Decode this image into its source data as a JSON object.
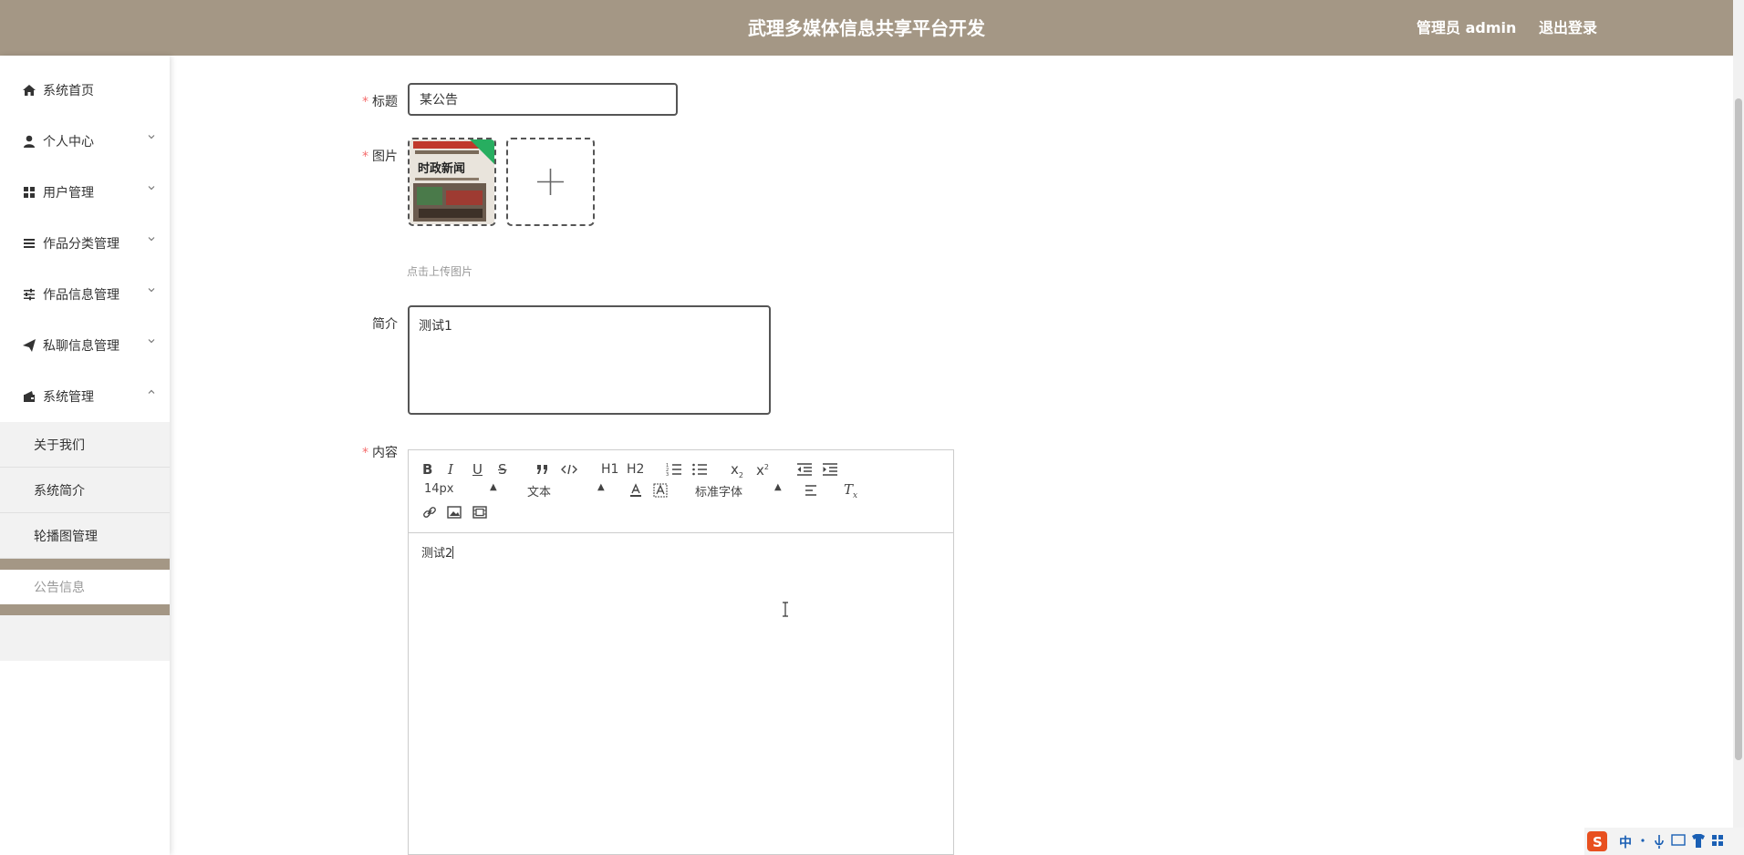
{
  "header": {
    "title": "武理多媒体信息共享平台开发",
    "admin_label": "管理员 admin",
    "logout_label": "退出登录"
  },
  "sidebar": {
    "items": [
      {
        "label": "系统首页",
        "icon": "home-icon"
      },
      {
        "label": "个人中心",
        "icon": "user-icon"
      },
      {
        "label": "用户管理",
        "icon": "grid-icon"
      },
      {
        "label": "作品分类管理",
        "icon": "list-icon"
      },
      {
        "label": "作品信息管理",
        "icon": "sliders-icon"
      },
      {
        "label": "私聊信息管理",
        "icon": "send-icon"
      },
      {
        "label": "系统管理",
        "icon": "wallet-icon"
      }
    ],
    "subitems": [
      {
        "label": "关于我们"
      },
      {
        "label": "系统简介"
      },
      {
        "label": "轮播图管理"
      },
      {
        "label": "公告信息"
      }
    ]
  },
  "form": {
    "title_label": "标题",
    "title_value": "某公告",
    "image_label": "图片",
    "upload_hint": "点击上传图片",
    "thumb_text": "时政新闻",
    "intro_label": "简介",
    "intro_value": "测试1",
    "content_label": "内容",
    "content_value": "测试2"
  },
  "editor": {
    "font_size": "14px",
    "header_select": "文本",
    "font_family": "标准字体",
    "h1": "H1",
    "h2": "H2"
  },
  "tray": {
    "ime_label": "中"
  },
  "colors": {
    "brand": "#a49785",
    "required": "#f56c6c"
  }
}
